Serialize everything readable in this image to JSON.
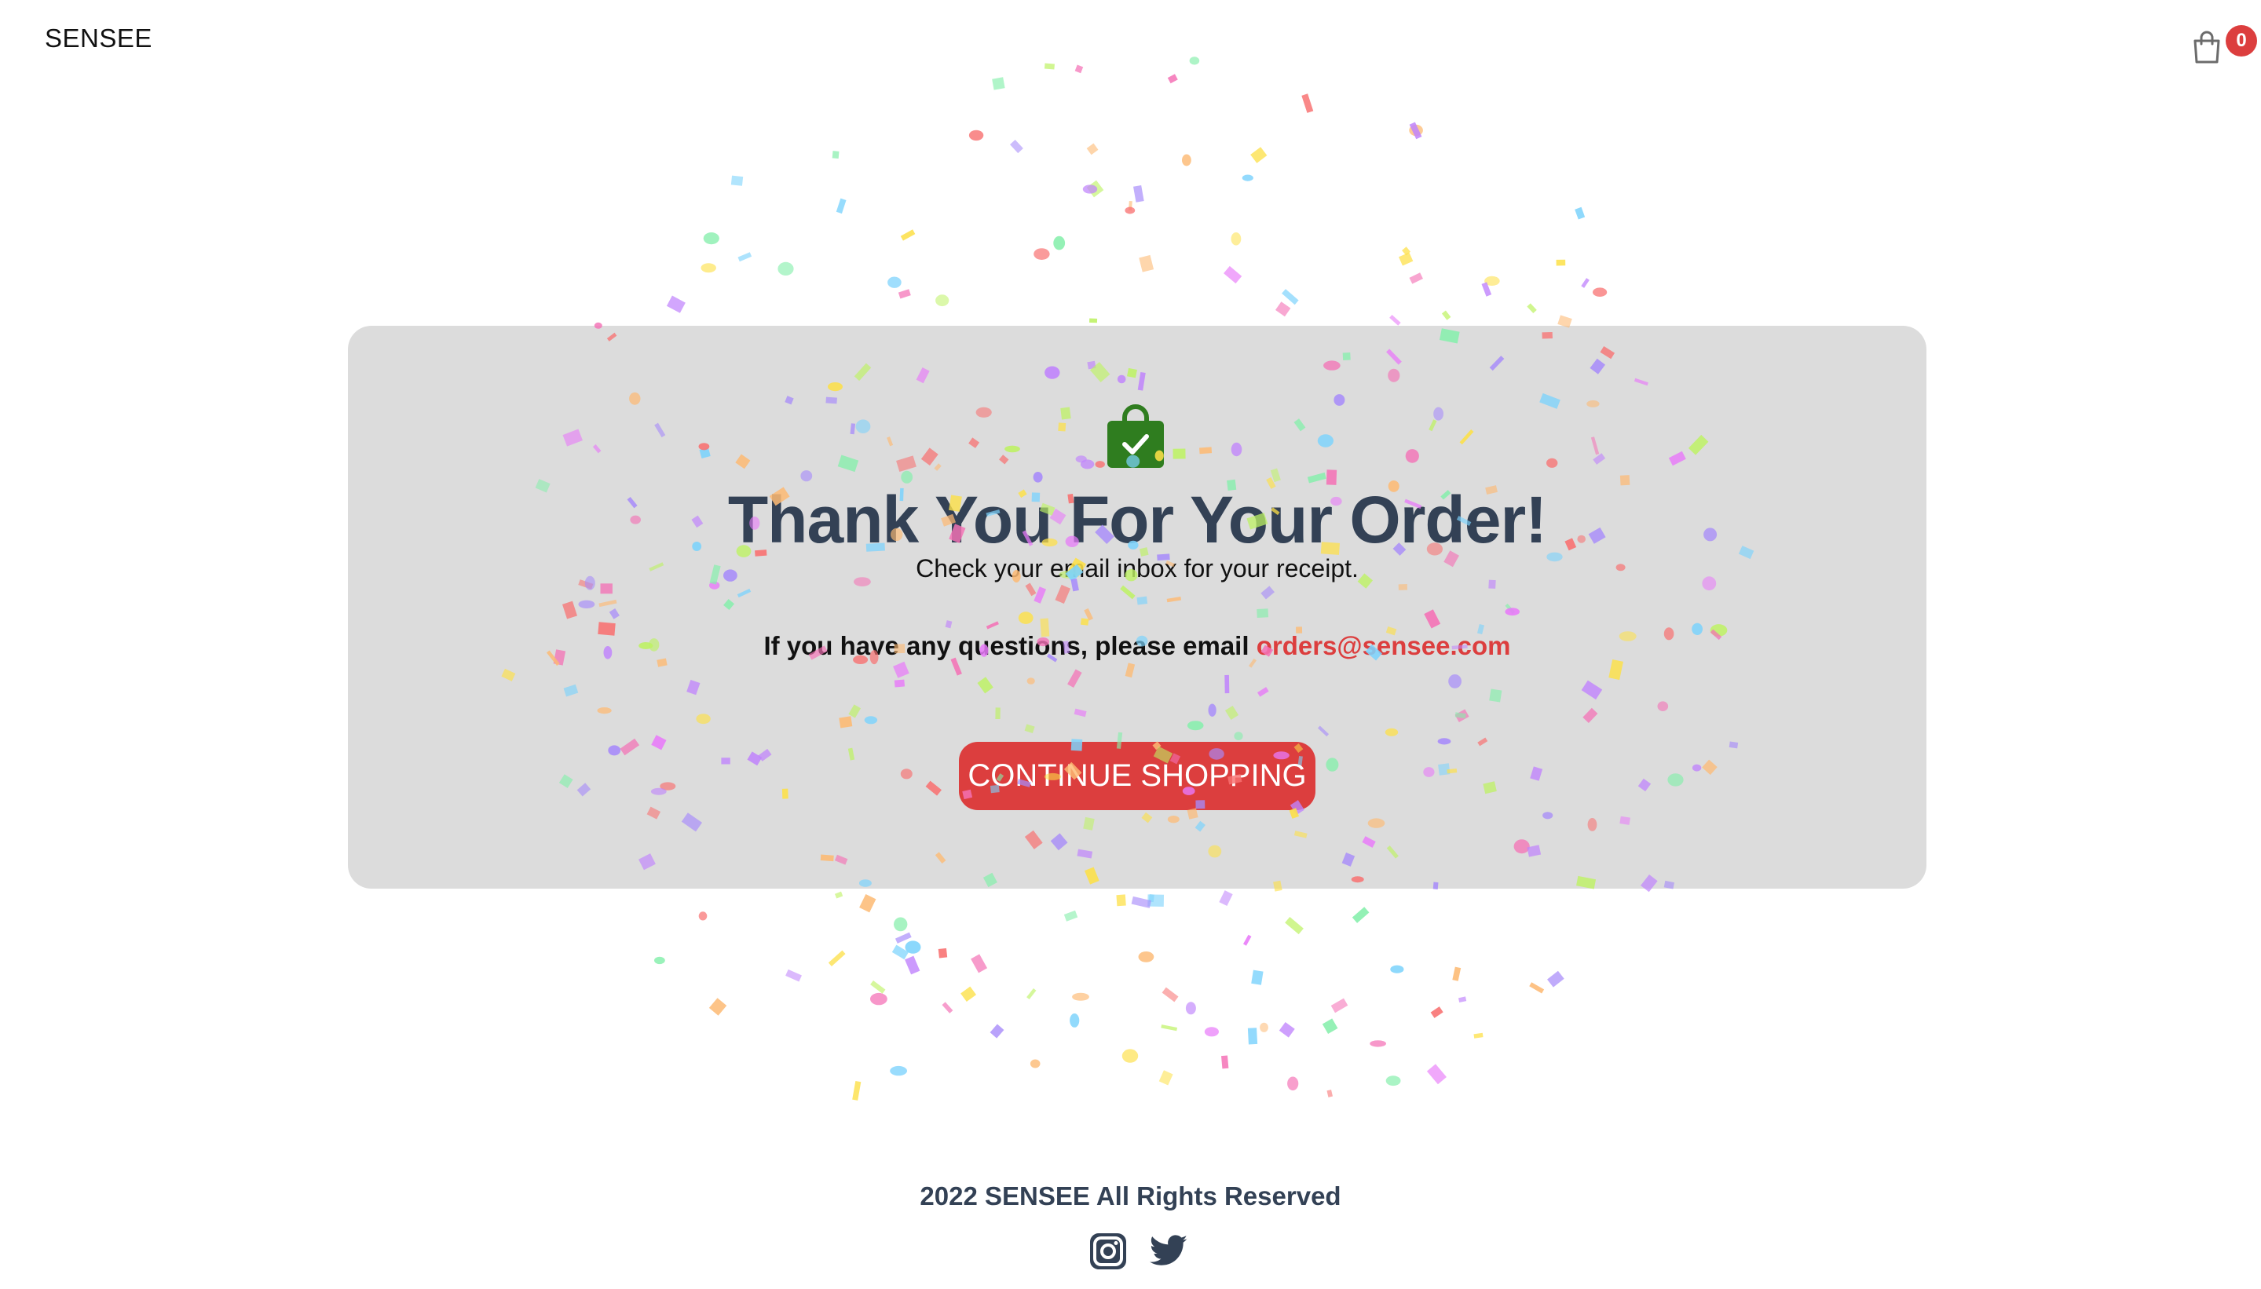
{
  "brand": {
    "name": "SENSEE"
  },
  "cart": {
    "count": "0",
    "badge_color": "#dc3e3e",
    "icon": "shopping-bag-icon"
  },
  "confirmation": {
    "icon": "shopping-bag-check-icon",
    "icon_color": "#2f7d1f",
    "title": "Thank You For Your Order!",
    "subtitle": "Check your email inbox for your receipt.",
    "question_text": "If you have any questions, please email",
    "email": "orders@sensee.com",
    "email_color": "#dc3e3e"
  },
  "cta": {
    "label": "CONTINUE SHOPPING",
    "color": "#dc3e3e"
  },
  "footer": {
    "copyright": "2022 SENSEE All Rights Reserved",
    "social": [
      {
        "name": "instagram-icon"
      },
      {
        "name": "twitter-icon"
      }
    ]
  },
  "colors": {
    "card_background": "#dcdcdc",
    "heading": "#334155",
    "confetti": [
      "#f472b6",
      "#c084fc",
      "#7dd3fc",
      "#fde047",
      "#86efac",
      "#fdba74",
      "#f87171",
      "#a78bfa",
      "#e879f9",
      "#bef264"
    ]
  }
}
